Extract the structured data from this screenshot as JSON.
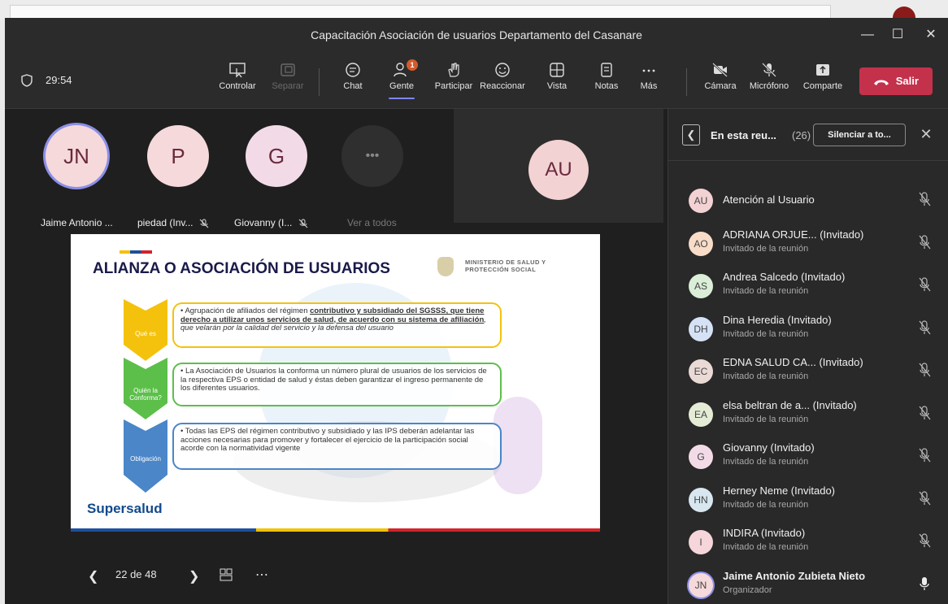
{
  "window": {
    "title": "Capacitación Asociación de usuarios Departamento del Casanare"
  },
  "toolbar": {
    "timer": "29:54",
    "buttons": [
      {
        "label": "Controlar",
        "icon": "share-control-icon",
        "disabled": false
      },
      {
        "label": "Separar",
        "icon": "popout-icon",
        "disabled": true
      },
      {
        "label": "Chat",
        "icon": "chat-icon",
        "disabled": false
      },
      {
        "label": "Gente",
        "icon": "people-icon",
        "disabled": false,
        "badge": "1",
        "active": true
      },
      {
        "label": "Participar",
        "icon": "raise-hand-icon",
        "disabled": false
      },
      {
        "label": "Reaccionar",
        "icon": "emoji-icon",
        "disabled": false
      },
      {
        "label": "Vista",
        "icon": "grid-view-icon",
        "disabled": false
      },
      {
        "label": "Notas",
        "icon": "notes-icon",
        "disabled": false
      },
      {
        "label": "Más",
        "icon": "more-icon",
        "disabled": false
      },
      {
        "label": "Cámara",
        "icon": "camera-off-icon",
        "disabled": false
      },
      {
        "label": "Micrófono",
        "icon": "mic-off-icon",
        "disabled": false
      },
      {
        "label": "Comparte",
        "icon": "share-icon",
        "disabled": false
      }
    ],
    "leave_label": "Salir"
  },
  "stage": {
    "tiles": [
      {
        "initials": "JN",
        "name": "Jaime Antonio ...",
        "muted": false
      },
      {
        "initials": "P",
        "name": "piedad (Inv...",
        "muted": true
      },
      {
        "initials": "G",
        "name": "Giovanny (I...",
        "muted": true
      }
    ],
    "see_all_label": "Ver a todos",
    "big_tile_initials": "AU",
    "slide": {
      "title": "ALIANZA O ASOCIACIÓN DE USUARIOS",
      "ministry": "MINISTERIO DE SALUD Y PROTECCIÓN SOCIAL",
      "rows": [
        {
          "label": "Qué es",
          "color": "#f4c20d",
          "text_a": "• Agrupación de afiliados del régimen ",
          "text_b": "contributivo y subsidiado del SGSSS, que tiene derecho a utilizar unos servicios de salud, de acuerdo con su sistema de afiliación",
          "text_c": ", que velarán por la calidad del servicio y la defensa del usuario"
        },
        {
          "label": "Quién la Conforma?",
          "color": "#5cbf4a",
          "text": "• La Asociación de Usuarios la conforma un número plural de usuarios de los servicios de la respectiva EPS o entidad de salud y éstas deben garantizar el ingreso permanente de los diferentes usuarios."
        },
        {
          "label": "Obligación",
          "color": "#4a86c8",
          "text": "• Todas las EPS del régimen contributivo y subsidiado y las IPS deberán adelantar las acciones necesarias para promover y fortalecer el ejercicio de la participación social acorde con la normatividad vigente"
        }
      ],
      "brand": "Supersalud"
    },
    "nav": {
      "page": "22 de 48"
    }
  },
  "panel": {
    "title": "En esta reu...",
    "count": "(26)",
    "mute_all": "Silenciar a to...",
    "participants": [
      {
        "initials": "AU",
        "name": "Atención al Usuario",
        "role": "",
        "color": "#f3d2d4",
        "mic": "off"
      },
      {
        "initials": "AO",
        "name": "ADRIANA ORJUE... (Invitado)",
        "role": "Invitado de la reunión",
        "color": "#f8dcc8",
        "mic": "off"
      },
      {
        "initials": "AS",
        "name": "Andrea Salcedo (Invitado)",
        "role": "Invitado de la reunión",
        "color": "#dbeed8",
        "mic": "off"
      },
      {
        "initials": "DH",
        "name": "Dina Heredia (Invitado)",
        "role": "Invitado de la reunión",
        "color": "#d5e2f5",
        "mic": "off"
      },
      {
        "initials": "EC",
        "name": "EDNA SALUD CA... (Invitado)",
        "role": "Invitado de la reunión",
        "color": "#eadad6",
        "mic": "off"
      },
      {
        "initials": "EA",
        "name": "elsa beltran de a... (Invitado)",
        "role": "Invitado de la reunión",
        "color": "#e5ecd6",
        "mic": "off"
      },
      {
        "initials": "G",
        "name": "Giovanny (Invitado)",
        "role": "Invitado de la reunión",
        "color": "#f2dbe7",
        "mic": "off"
      },
      {
        "initials": "HN",
        "name": "Herney Neme (Invitado)",
        "role": "Invitado de la reunión",
        "color": "#d8e6ef",
        "mic": "off"
      },
      {
        "initials": "I",
        "name": "INDIRA (Invitado)",
        "role": "Invitado de la reunión",
        "color": "#f6d6da",
        "mic": "off"
      },
      {
        "initials": "JN",
        "name": "Jaime Antonio Zubieta Nieto",
        "role": "Organizador",
        "color": "#f6d9db",
        "mic": "on"
      }
    ]
  }
}
